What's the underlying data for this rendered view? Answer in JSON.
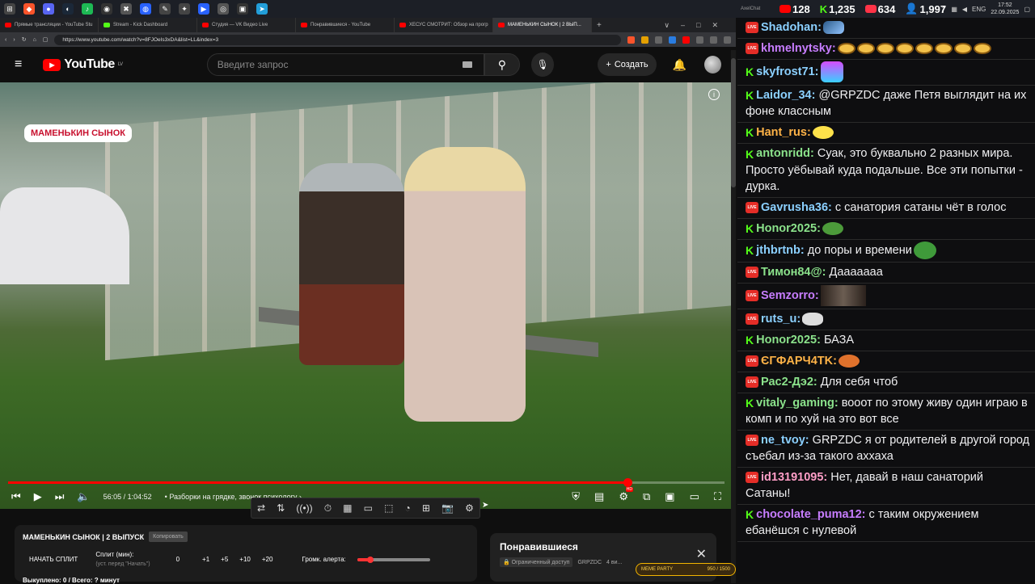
{
  "taskbar": {
    "clock_time": "17:52",
    "clock_date": "22.09.2025",
    "lang": "ENG"
  },
  "browser": {
    "tabs": [
      "Прямые трансляции - YouTube Stu",
      "Stream - Kick Dashboard",
      "Студия — VK Видео Live",
      "Понравившиеся - YouTube",
      "ХЕСУС СМОТРИТ: Обзор на прогр",
      "МАМЕНЬКИН СЫНОК | 2 ВЫП..."
    ],
    "url": "https://www.youtube.com/watch?v=8FJOeIs3xDA&list=LL&index=3"
  },
  "youtube": {
    "logo": "YouTube",
    "logo_country": "LV",
    "search_placeholder": "Введите запрос",
    "create_label": "Создать"
  },
  "video": {
    "badge": "МАМЕНЬКИН СЫНОК",
    "time": "56:05 / 1:04:52",
    "chapter": "Разборки на грядке, звонок психологу",
    "progress": 0.865
  },
  "split": {
    "title": "МАМЕНЬКИН СЫНОК | 2 ВЫПУСК",
    "copy_label": "Копировать",
    "start_label": "НАЧАТЬ СПЛИТ",
    "split_min_label": "Сплит (мин):",
    "split_min_hint": "(уст. перед \"Начать\")",
    "split_value": "0",
    "add_buttons": [
      "+1",
      "+5",
      "+10",
      "+20"
    ],
    "alert_label": "Громк. алерта:",
    "alert_level": 0.18,
    "bought": "Выкуплено: 0 / Всего: ? минут"
  },
  "liked": {
    "title": "Понравившиеся",
    "access": "Ограниченный доступ",
    "channel": "GRPZDC",
    "count": "4 ви..."
  },
  "meme_badge": {
    "label": "MEME PARTY",
    "count": "950 / 1500"
  },
  "chat": {
    "app_label": "AxelChat",
    "stats": {
      "youtube": "128",
      "kick": "1,235",
      "vk": "634",
      "viewers": "1,997"
    },
    "messages": [
      {
        "platform": "live",
        "nick": "Shadohan:",
        "color": "#8bd0ff",
        "text": "",
        "emote": "sword"
      },
      {
        "platform": "live",
        "nick": "khmelnytsky:",
        "color": "#c77dff",
        "text": "",
        "emote": "pancakes"
      },
      {
        "platform": "kick",
        "nick": "skyfrost71:",
        "color": "#8bd0ff",
        "text": "",
        "emote": "robot"
      },
      {
        "platform": "kick",
        "nick": "Laidor_34:",
        "color": "#8bd0ff",
        "text": "@GRPZDC даже Петя выглядит на их фоне классным"
      },
      {
        "platform": "kick",
        "nick": "Hant_rus:",
        "color": "#ffb347",
        "text": "",
        "emote": "duck"
      },
      {
        "platform": "kick",
        "nick": "antonridd:",
        "color": "#8be28b",
        "text": "Суак, это буквально 2 разных мира. Просто уёбывай куда подальше. Все эти попытки - дурка."
      },
      {
        "platform": "live",
        "nick": "Gavrusha36:",
        "color": "#8bd0ff",
        "text": "с санатория сатаны чёт в голос"
      },
      {
        "platform": "kick",
        "nick": "Honor2025:",
        "color": "#8be28b",
        "text": "",
        "emote": "pepe"
      },
      {
        "platform": "kick",
        "nick": "jthbrtnb:",
        "color": "#8bd0ff",
        "text": "до поры и времени",
        "emote": "pepe-laugh"
      },
      {
        "platform": "live",
        "nick": "Тимон84@:",
        "color": "#8be28b",
        "text": "Дааааааа"
      },
      {
        "platform": "live",
        "nick": "Semzorro:",
        "color": "#c77dff",
        "text": "",
        "emote": "photo"
      },
      {
        "platform": "live",
        "nick": "ruts_u:",
        "color": "#8bd0ff",
        "text": "",
        "emote": "cat"
      },
      {
        "platform": "kick",
        "nick": "Honor2025:",
        "color": "#8be28b",
        "text": "БАЗА"
      },
      {
        "platform": "live",
        "nick": "ЄΓФΑΡЧ4ΤΚ:",
        "color": "#ffb347",
        "text": "",
        "emote": "character"
      },
      {
        "platform": "live",
        "nick": "Рас2-Дэ2:",
        "color": "#8be28b",
        "text": "Для себя чтоб"
      },
      {
        "platform": "kick",
        "nick": "vitaly_gaming:",
        "color": "#8be28b",
        "text": "вооот по этому живу один играю в комп и по хуй на это вот все"
      },
      {
        "platform": "live",
        "nick": "ne_tvoy:",
        "color": "#8bd0ff",
        "text": "GRPZDC я от родителей в другой город съебал из-за такого аххаха"
      },
      {
        "platform": "live",
        "nick": "id13191095:",
        "color": "#ff9ec7",
        "text": "Нет, давай в наш санаторий Сатаны!"
      },
      {
        "platform": "kick",
        "nick": "chocolate_puma12:",
        "color": "#c77dff",
        "text": "с таким окружением ебанёшся с нулевой"
      }
    ]
  }
}
